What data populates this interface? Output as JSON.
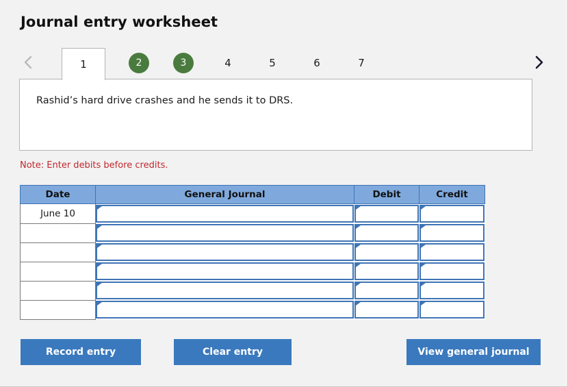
{
  "page": {
    "title": "Journal entry worksheet",
    "background_color": "#f2f2f2"
  },
  "colors": {
    "tab_done": "#4a7b3e",
    "table_header": "#7fa9dd",
    "cell_accent": "#3e74b4",
    "button": "#3a79bd",
    "note": "#c0272d"
  },
  "tabs": {
    "prev_icon": "chevron-left-icon",
    "next_icon": "chevron-right-icon",
    "items": [
      {
        "label": "1",
        "state": "selected"
      },
      {
        "label": "2",
        "state": "done"
      },
      {
        "label": "3",
        "state": "done"
      },
      {
        "label": "4",
        "state": "plain"
      },
      {
        "label": "5",
        "state": "plain"
      },
      {
        "label": "6",
        "state": "plain"
      },
      {
        "label": "7",
        "state": "plain"
      }
    ]
  },
  "content": {
    "text": "Rashid’s hard drive crashes and he sends it to DRS."
  },
  "note": {
    "text": "Note: Enter debits before credits."
  },
  "journal": {
    "headers": [
      "Date",
      "General Journal",
      "Debit",
      "Credit"
    ],
    "rows": [
      {
        "date": "June 10",
        "general_journal": "",
        "debit": "",
        "credit": ""
      },
      {
        "date": "",
        "general_journal": "",
        "debit": "",
        "credit": ""
      },
      {
        "date": "",
        "general_journal": "",
        "debit": "",
        "credit": ""
      },
      {
        "date": "",
        "general_journal": "",
        "debit": "",
        "credit": ""
      },
      {
        "date": "",
        "general_journal": "",
        "debit": "",
        "credit": ""
      },
      {
        "date": "",
        "general_journal": "",
        "debit": "",
        "credit": ""
      }
    ]
  },
  "buttons": {
    "record": "Record entry",
    "clear": "Clear entry",
    "view": "View general journal"
  }
}
